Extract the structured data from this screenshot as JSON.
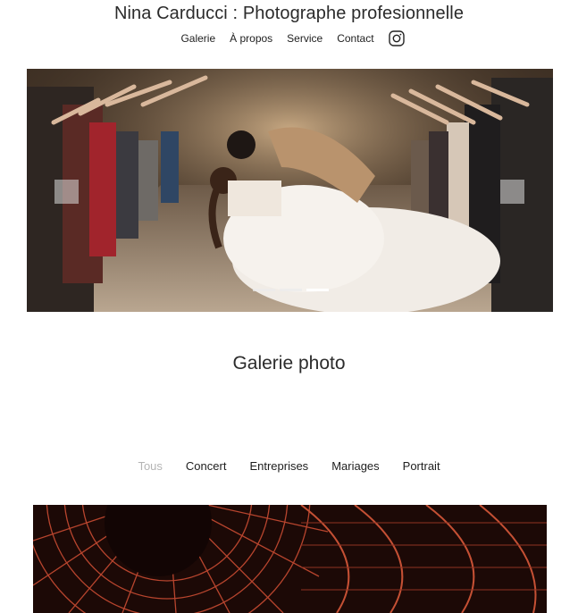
{
  "site": {
    "title": "Nina Carducci : Photographe profesionnelle"
  },
  "nav": {
    "items": [
      "Galerie",
      "À propos",
      "Service",
      "Contact"
    ],
    "social_icon": "instagram-icon"
  },
  "carousel": {
    "slide_count": 3,
    "active_index": 2,
    "prev_icon": "chevron-left-icon",
    "next_icon": "chevron-right-icon",
    "image": "wedding couple kiss with guests"
  },
  "gallery": {
    "title": "Galerie photo",
    "filters": [
      "Tous",
      "Concert",
      "Entreprises",
      "Mariages",
      "Portrait"
    ],
    "active_filter": "Tous",
    "first_photo": "concert stage lighting rig"
  },
  "colors": {
    "active_filter": "#b4b4b4",
    "text": "#1e1e1e"
  }
}
